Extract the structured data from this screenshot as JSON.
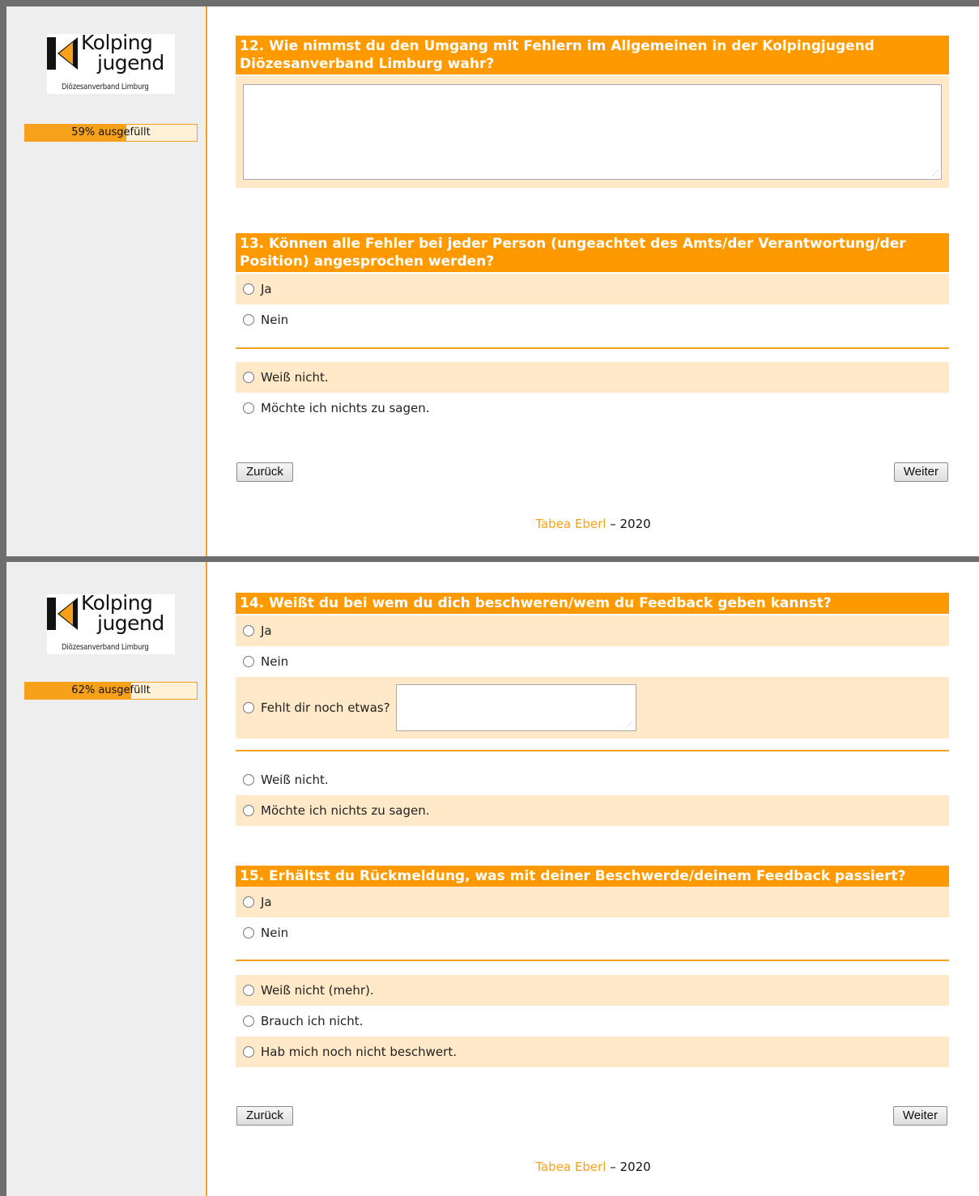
{
  "logo": {
    "line1": "Kolping",
    "line2": "jugend",
    "subtitle": "Diözesanverband Limburg"
  },
  "colors": {
    "accent": "#ff9900",
    "row_alt": "#ffe9c8",
    "sidebar": "#eeeeee"
  },
  "page1": {
    "progress": {
      "label": "59% ausgefüllt",
      "value": 0.59
    },
    "q12": {
      "title": "12. Wie nimmst du den Umgang mit Fehlern im Allgemeinen in der Kolpingjugend Diözesanverband Limburg wahr?",
      "answer": ""
    },
    "q13": {
      "title": "13. Können alle Fehler bei jeder Person (ungeachtet des Amts/der Verantwortung/der Position) angesprochen werden?",
      "options": [
        "Ja",
        "Nein",
        "Weiß nicht.",
        "Möchte ich nichts zu sagen."
      ]
    },
    "back_label": "Zurück",
    "next_label": "Weiter",
    "footer": {
      "author": "Tabea Eberl",
      "rest": " – 2020"
    }
  },
  "page2": {
    "progress": {
      "label": "62% ausgefüllt",
      "value": 0.62
    },
    "q14": {
      "title": "14. Weißt du bei wem du dich beschweren/wem du Feedback geben kannst?",
      "options": [
        "Ja",
        "Nein",
        "Fehlt dir noch etwas?",
        "Weiß nicht.",
        "Möchte ich nichts zu sagen."
      ],
      "other_value": ""
    },
    "q15": {
      "title": "15. Erhältst du Rückmeldung, was mit deiner Beschwerde/deinem Feedback passiert?",
      "options": [
        "Ja",
        "Nein",
        "Weiß nicht (mehr).",
        "Brauch ich nicht.",
        "Hab mich noch nicht beschwert."
      ]
    },
    "back_label": "Zurück",
    "next_label": "Weiter",
    "footer": {
      "author": "Tabea Eberl",
      "rest": " – 2020"
    }
  }
}
